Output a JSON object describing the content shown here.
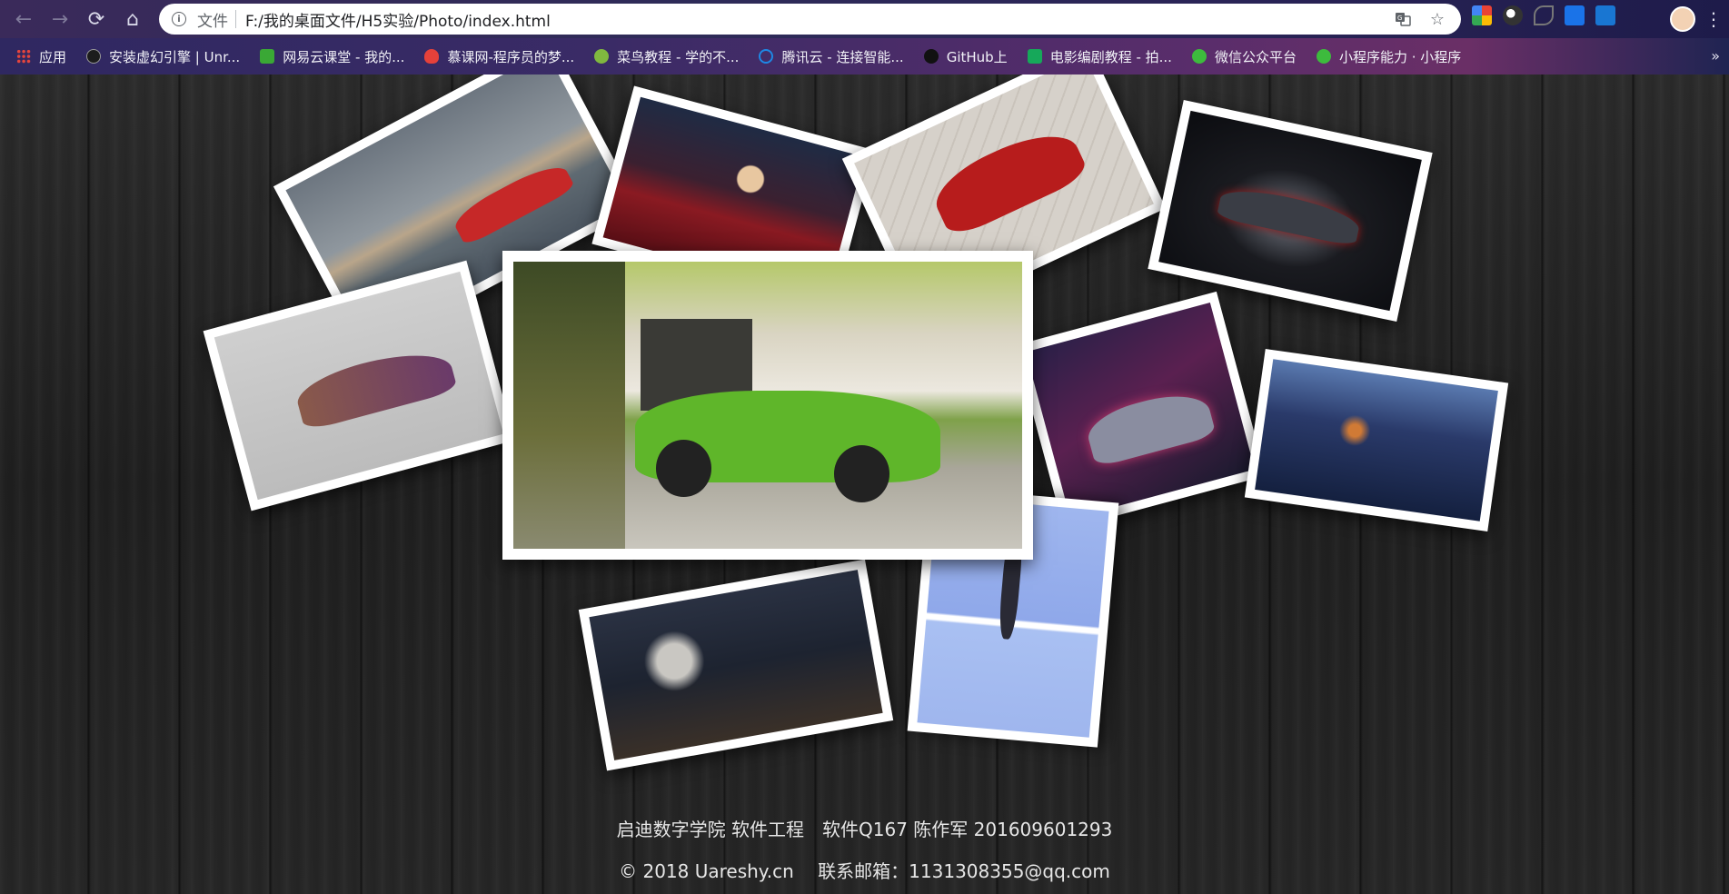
{
  "browser": {
    "nav": {
      "back": "←",
      "forward": "→",
      "reload": "⟳",
      "home": "⌂"
    },
    "omnibox": {
      "scheme_label": "文件",
      "url": "F:/我的桌面文件/H5实验/Photo/index.html"
    },
    "menu": "⋮"
  },
  "bookmarks": {
    "items": [
      {
        "label": "应用",
        "color": "#e8453c"
      },
      {
        "label": "安装虚幻引擎 | Unr...",
        "color": "#2b2b2b"
      },
      {
        "label": "网易云课堂 - 我的...",
        "color": "#3aa835"
      },
      {
        "label": "慕课网-程序员的梦...",
        "color": "#e6413a"
      },
      {
        "label": "菜鸟教程 - 学的不...",
        "color": "#80b83f"
      },
      {
        "label": "腾讯云 - 连接智能...",
        "color": "#1e88e5"
      },
      {
        "label": "GitHub上",
        "color": "#111111"
      },
      {
        "label": "电影编剧教程 - 拍...",
        "color": "#16a85a"
      },
      {
        "label": "微信公众平台",
        "color": "#3dbb3d"
      },
      {
        "label": "小程序能力 · 小程序",
        "color": "#3dbb3d"
      }
    ],
    "more": "»"
  },
  "gallery": {
    "photos": [
      {
        "name": "photo-red-car-harbor",
        "colors": [
          "#8a939c",
          "#c9b49b",
          "#c92a2a"
        ]
      },
      {
        "name": "photo-girl-red-car",
        "colors": [
          "#2a3a55",
          "#8a1a22",
          "#d14b4b"
        ]
      },
      {
        "name": "photo-red-supercar-tiles",
        "colors": [
          "#d9d4cd",
          "#b71c1c",
          "#8e8a85"
        ]
      },
      {
        "name": "photo-dark-supercar",
        "colors": [
          "#0e0f14",
          "#3a3d45",
          "#9b1b1b"
        ]
      },
      {
        "name": "photo-purple-lamborghini",
        "colors": [
          "#d8d8d8",
          "#7a4a6a",
          "#b9b9b9"
        ]
      },
      {
        "name": "photo-green-lamborghini",
        "colors": [
          "#e7e1cf",
          "#58b52b",
          "#6d8d3a"
        ]
      },
      {
        "name": "photo-neon-car",
        "colors": [
          "#261a3a",
          "#c0396b",
          "#4a6bbf"
        ]
      },
      {
        "name": "photo-city-night-girl",
        "colors": [
          "#2a3a6a",
          "#c97a3a",
          "#101a35"
        ]
      },
      {
        "name": "photo-witcher-girl",
        "colors": [
          "#1d2330",
          "#5a6070",
          "#c99a55"
        ]
      },
      {
        "name": "photo-standing-figure",
        "colors": [
          "#9fb6ee",
          "#8aa6e8",
          "#2a2a35"
        ]
      }
    ]
  },
  "footer": {
    "line1": "启迪数字学院 软件工程　软件Q167 陈作军 201609601293",
    "line2": "© 2018 Uareshy.cn　 联系邮箱：1131308355@qq.com"
  }
}
